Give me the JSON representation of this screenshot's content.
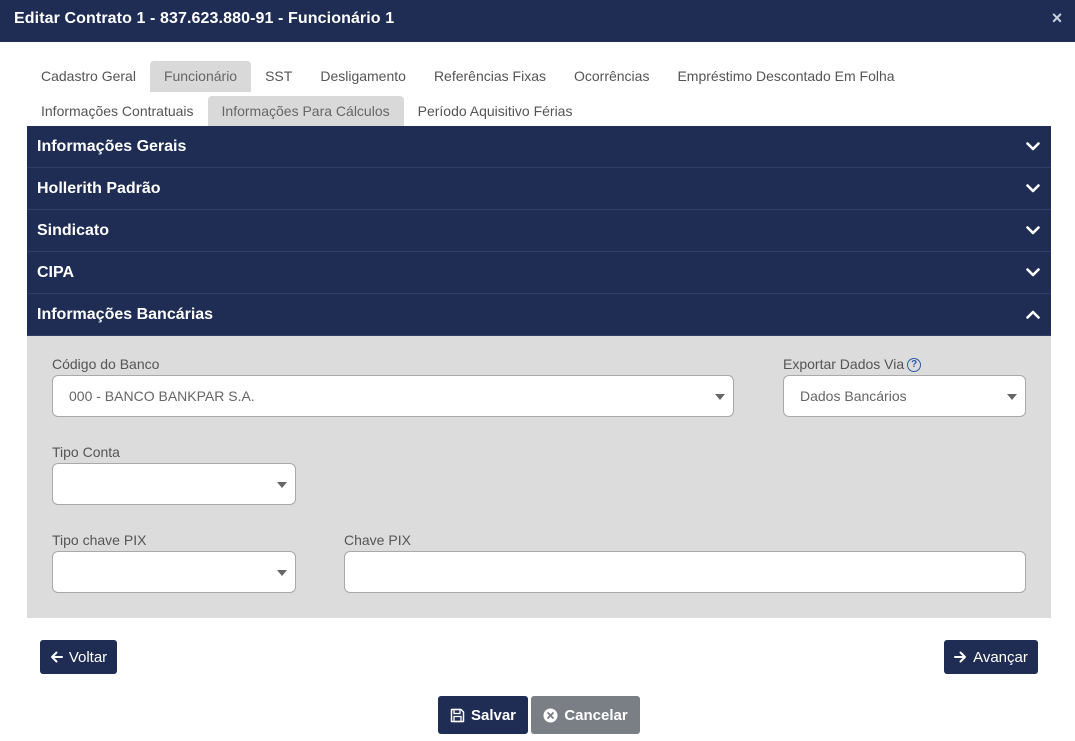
{
  "window": {
    "title": "Editar Contrato 1 - 837.623.880-91 - Funcionário 1",
    "close_label": "×"
  },
  "tabs": {
    "row1": [
      "Cadastro Geral",
      "Funcionário",
      "SST",
      "Desligamento",
      "Referências Fixas",
      "Ocorrências",
      "Empréstimo Descontado Em Folha"
    ],
    "row2": [
      "Informações Contratuais",
      "Informações Para Cálculos",
      "Período Aquisitivo Férias"
    ],
    "active": [
      "Funcionário",
      "Informações Para Cálculos"
    ]
  },
  "accordion": {
    "sections": [
      "Informações Gerais",
      "Hollerith Padrão",
      "Sindicato",
      "CIPA",
      "Informações Bancárias"
    ],
    "expanded": "Informações Bancárias"
  },
  "bank_form": {
    "codigo_banco_label": "Código do Banco",
    "codigo_banco_value": "000 - BANCO BANKPAR S.A.",
    "exportar_label": "Exportar Dados Via",
    "help_glyph": "?",
    "exportar_value": "Dados Bancários",
    "tipo_conta_label": "Tipo Conta",
    "tipo_conta_value": "",
    "tipo_pix_label": "Tipo chave PIX",
    "tipo_pix_value": "",
    "chave_pix_label": "Chave PIX",
    "chave_pix_value": ""
  },
  "buttons": {
    "voltar": "Voltar",
    "avancar": "Avançar",
    "salvar": "Salvar",
    "cancelar": "Cancelar"
  },
  "colors": {
    "header_navy": "#1f2d54",
    "panel_gray": "#dcdcdc",
    "cancel_gray": "#7a7f86"
  }
}
